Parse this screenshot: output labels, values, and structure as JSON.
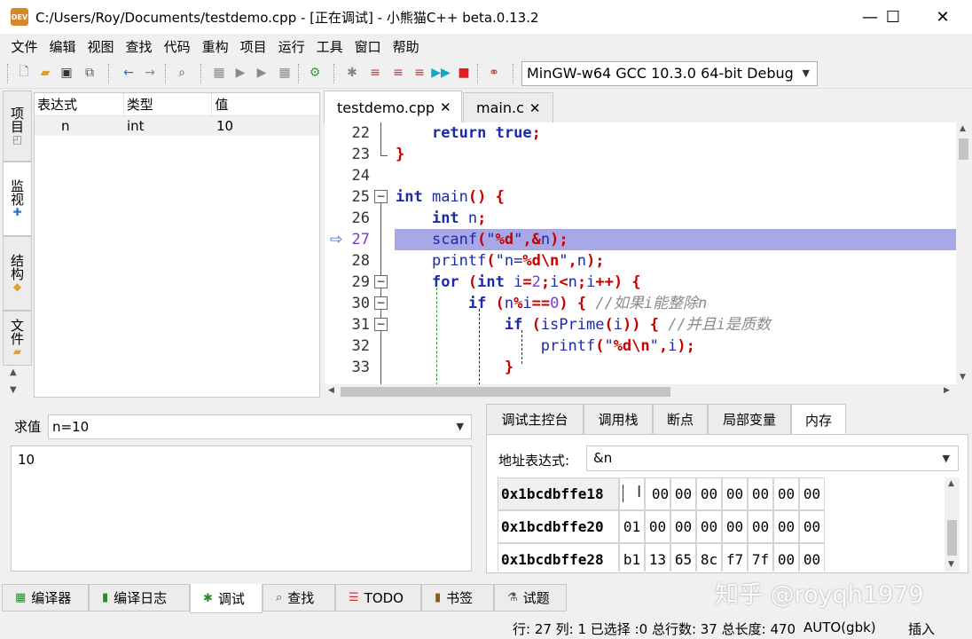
{
  "window": {
    "title": "C:/Users/Roy/Documents/testdemo.cpp - [正在调试] - 小熊猫C++ beta.0.13.2",
    "icon_text": "DEV",
    "minimize": "—",
    "maximize": "☐",
    "close": "✕"
  },
  "menu": [
    "文件",
    "编辑",
    "视图",
    "查找",
    "代码",
    "重构",
    "项目",
    "运行",
    "工具",
    "窗口",
    "帮助"
  ],
  "toolbar": {
    "compiler": "MinGW-w64 GCC 10.3.0 64-bit Debug"
  },
  "left_tabs": [
    "项目",
    "监视",
    "结构",
    "文件"
  ],
  "watch": {
    "headers": [
      "表达式",
      "类型",
      "值"
    ],
    "rows": [
      {
        "expr": "n",
        "type": "int",
        "value": "10"
      }
    ]
  },
  "editor_tabs": [
    {
      "name": "testdemo.cpp",
      "close": "✕"
    },
    {
      "name": "main.c",
      "close": "✕"
    }
  ],
  "editor": {
    "lines": [
      "22",
      "23",
      "24",
      "25",
      "26",
      "27",
      "28",
      "29",
      "30",
      "31",
      "32",
      "33"
    ],
    "current_line": "27",
    "comments": [
      "//如果i能整除n",
      "//并且i是质数"
    ]
  },
  "eval": {
    "label": "求值",
    "input": "n=10",
    "output": "10"
  },
  "debug_tabs": [
    "调试主控台",
    "调用栈",
    "断点",
    "局部变量",
    "内存"
  ],
  "memory": {
    "addr_label": "地址表达式:",
    "addr_value": "&n",
    "rows": [
      {
        "addr": "0x1bcdbffe18",
        "bytes": [
          "0a",
          "00",
          "00",
          "00",
          "00",
          "00",
          "00",
          "00"
        ]
      },
      {
        "addr": "0x1bcdbffe20",
        "bytes": [
          "01",
          "00",
          "00",
          "00",
          "00",
          "00",
          "00",
          "00"
        ]
      },
      {
        "addr": "0x1bcdbffe28",
        "bytes": [
          "b1",
          "13",
          "65",
          "8c",
          "f7",
          "7f",
          "00",
          "00"
        ]
      }
    ]
  },
  "bottom_tabs": [
    "编译器",
    "编译日志",
    "调试",
    "查找",
    "TODO",
    "书签",
    "试题"
  ],
  "status": {
    "position": "行: 27 列: 1 已选择 :0 总行数: 37 总长度: 470",
    "encoding": "AUTO(gbk)",
    "mode": "插入"
  },
  "watermark": "知乎 @royqh1979"
}
